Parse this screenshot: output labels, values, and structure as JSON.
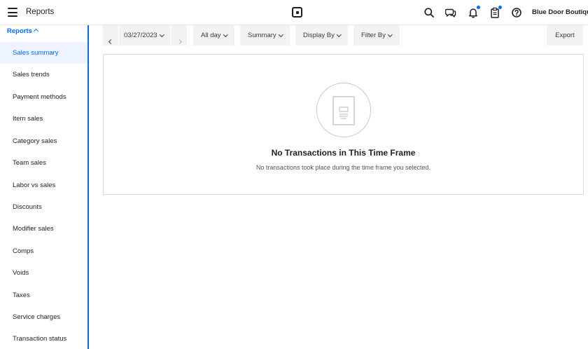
{
  "header": {
    "title": "Reports",
    "business_name": "Blue Door Boutique",
    "icons": [
      "menu-icon",
      "square-logo-icon",
      "search-icon",
      "messages-icon",
      "notifications-icon",
      "clipboard-icon",
      "help-icon"
    ],
    "badge_color": "#006aff"
  },
  "sidebar": {
    "section_label": "Reports",
    "items": [
      {
        "label": "Sales summary",
        "active": true
      },
      {
        "label": "Sales trends"
      },
      {
        "label": "Payment methods"
      },
      {
        "label": "Item sales"
      },
      {
        "label": "Category sales"
      },
      {
        "label": "Team sales"
      },
      {
        "label": "Labor vs sales"
      },
      {
        "label": "Discounts"
      },
      {
        "label": "Modifier sales"
      },
      {
        "label": "Comps"
      },
      {
        "label": "Voids"
      },
      {
        "label": "Taxes"
      },
      {
        "label": "Service charges"
      },
      {
        "label": "Transaction status"
      }
    ]
  },
  "toolbar": {
    "date": "03/27/2023",
    "time_range": "All day",
    "view": "Summary",
    "display_by": "Display By",
    "filter_by": "Filter By",
    "export": "Export"
  },
  "empty_state": {
    "title": "No Transactions in This Time Frame",
    "description": "No transactions took place during the time frame you selected."
  },
  "colors": {
    "accent": "#006aff",
    "active_bg": "#eef4ff",
    "button_bg": "#f2f2f2"
  }
}
